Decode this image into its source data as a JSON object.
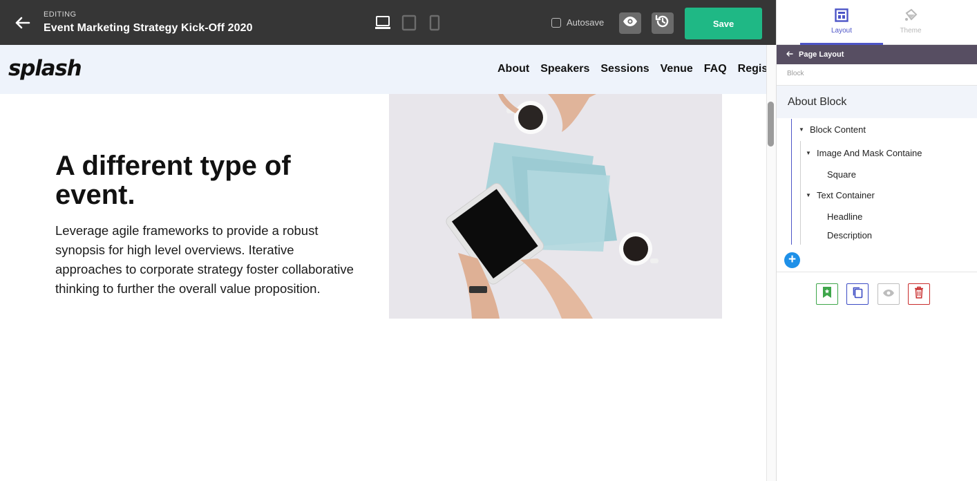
{
  "editor": {
    "editing_label": "EDITING",
    "event_title": "Event Marketing Strategy Kick-Off 2020",
    "autosave_label": "Autosave",
    "autosave_checked": false,
    "save_label": "Save",
    "device_modes": [
      "desktop",
      "tablet",
      "mobile"
    ],
    "active_device": "desktop"
  },
  "site": {
    "logo": "splash",
    "nav": [
      "About",
      "Speakers",
      "Sessions",
      "Venue",
      "FAQ",
      "Register"
    ],
    "headline": "A different type of event.",
    "description": "Leverage agile frameworks to provide a robust synopsis for high level overviews. Iterative approaches to corporate strategy foster collaborative thinking to further the overall value proposition."
  },
  "panel": {
    "tabs": [
      {
        "label": "Layout",
        "icon": "layout-grid-icon",
        "active": true
      },
      {
        "label": "Theme",
        "icon": "paint-bucket-icon",
        "active": false
      }
    ],
    "crumb": "Page Layout",
    "crumb_sub": "Block",
    "block_title": "About Block",
    "tree": {
      "block_content": "Block Content",
      "image_mask": "Image And Mask Containe",
      "square": "Square",
      "text_container": "Text Container",
      "headline": "Headline",
      "description": "Description"
    },
    "actions": [
      "bookmark-icon",
      "copy-icon",
      "eye-icon",
      "trash-icon"
    ]
  },
  "colors": {
    "topbar": "#363636",
    "save": "#1fb885",
    "accent": "#4d55c7",
    "crumb_bar": "#574e62",
    "site_header": "#eef3fb",
    "add": "#1e90e8",
    "delete": "#c82b2b",
    "bookmark": "#3ea64a"
  }
}
